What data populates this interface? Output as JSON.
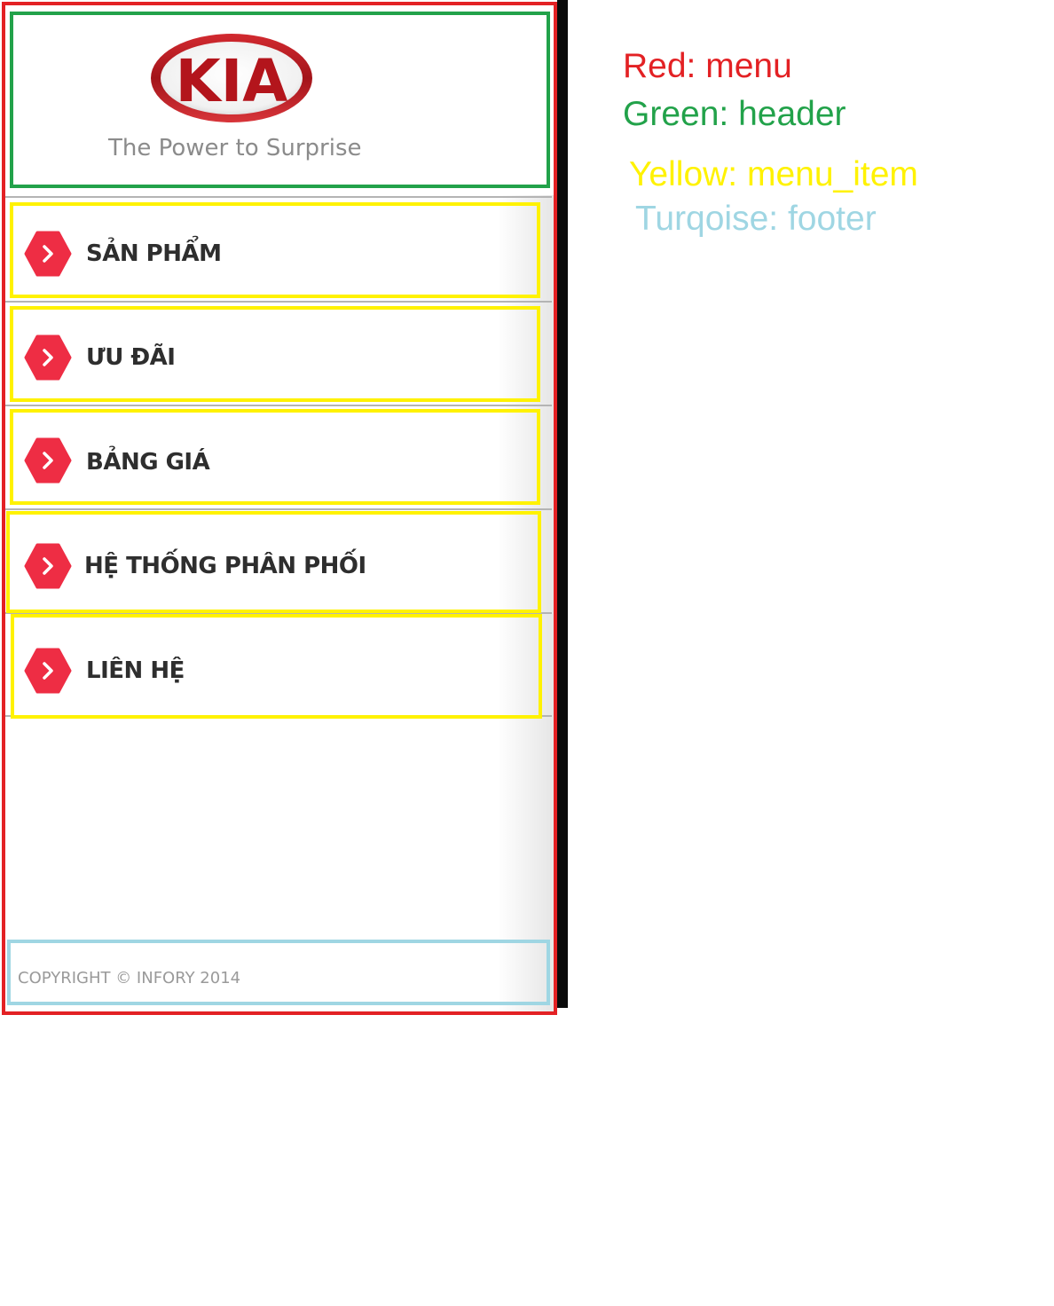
{
  "header": {
    "logo_text": "KIA",
    "tagline": "The Power to Surprise"
  },
  "menu": {
    "items": [
      {
        "label": "SẢN PHẨM",
        "icon": "chevron-right-icon"
      },
      {
        "label": "ƯU ĐÃI",
        "icon": "chevron-right-icon"
      },
      {
        "label": "BẢNG GIÁ",
        "icon": "chevron-right-icon"
      },
      {
        "label": "HỆ THỐNG PHÂN PHỐI",
        "icon": "chevron-right-icon"
      },
      {
        "label": "LIÊN HỆ",
        "icon": "chevron-right-icon"
      }
    ]
  },
  "footer": {
    "copyright": "COPYRIGHT © INFORY 2014"
  },
  "legend": {
    "red": "Red: menu",
    "green": "Green: header",
    "yellow": "Yellow: menu_item",
    "turquoise": "Turqoise: footer"
  },
  "colors": {
    "menu_outline": "#e32124",
    "header_outline": "#22a24a",
    "menu_item_outline": "#fff200",
    "footer_outline": "#9fd6e3",
    "icon_red": "#ee2d44",
    "logo_red": "#b3151c"
  }
}
